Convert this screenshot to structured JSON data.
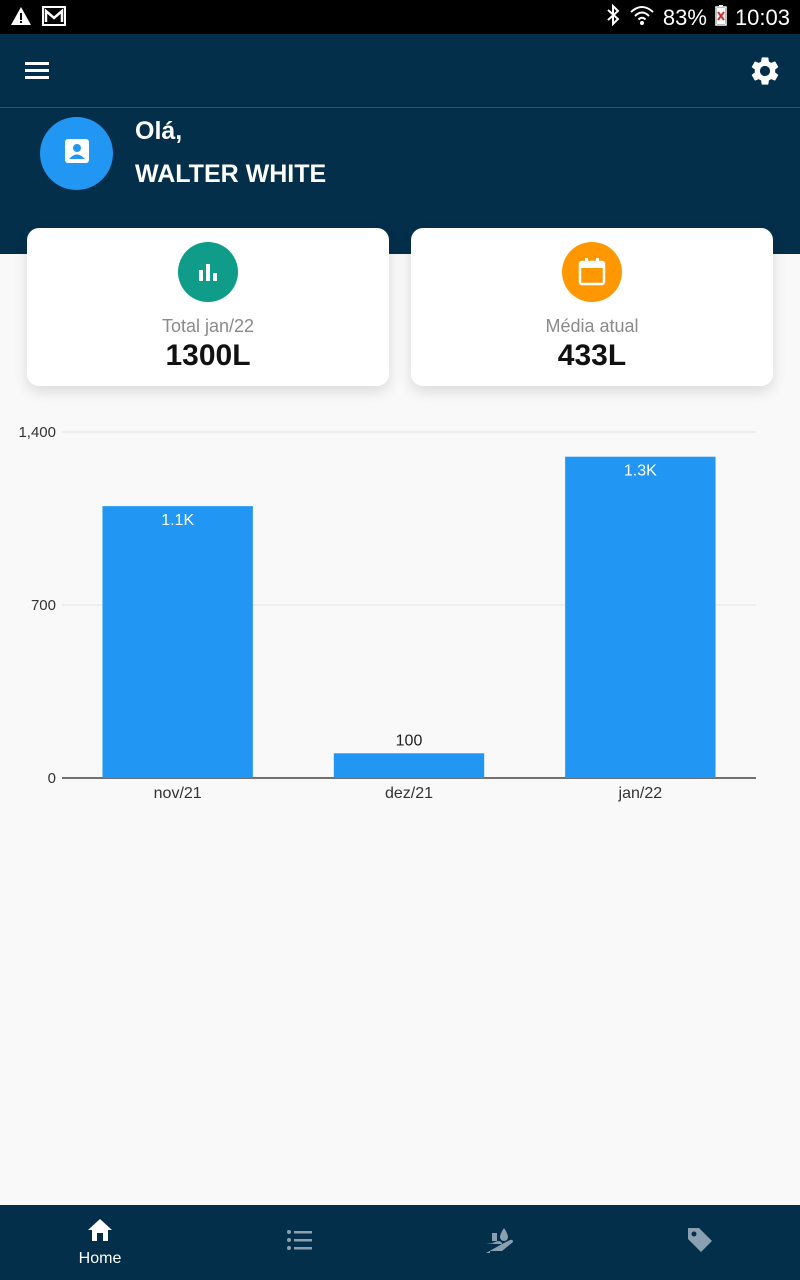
{
  "status_bar": {
    "battery": "83%",
    "time": "10:03",
    "icons": [
      "warning-icon",
      "gmail-icon",
      "bluetooth-icon",
      "wifi-icon",
      "battery-icon"
    ]
  },
  "header": {
    "greeting": "Olá,",
    "user_name": "WALTER WHITE",
    "icons": [
      "menu-icon",
      "gear-icon",
      "contact-icon"
    ]
  },
  "cards": [
    {
      "label": "Total jan/22",
      "value": "1300L",
      "icon": "bar-chart-icon",
      "color": "#0f9d8a"
    },
    {
      "label": "Média atual",
      "value": "433L",
      "icon": "calendar-icon",
      "color": "#ff9800"
    }
  ],
  "chart_data": {
    "type": "bar",
    "categories": [
      "nov/21",
      "dez/21",
      "jan/22"
    ],
    "values": [
      1100,
      100,
      1300
    ],
    "data_labels": [
      "1.1K",
      "100",
      "1.3K"
    ],
    "y_ticks": [
      "0",
      "700",
      "1,400"
    ],
    "ylim": [
      0,
      1400
    ],
    "grid": true,
    "bar_color": "#2196f3"
  },
  "bottom_nav": {
    "items": [
      {
        "label": "Home",
        "icon": "home-icon",
        "active": true
      },
      {
        "label": "",
        "icon": "list-icon",
        "active": false
      },
      {
        "label": "",
        "icon": "water-hand-icon",
        "active": false
      },
      {
        "label": "",
        "icon": "tag-icon",
        "active": false
      }
    ]
  },
  "colors": {
    "primary_dark": "#042f4b",
    "accent_blue": "#2196f3",
    "teal": "#0f9d8a",
    "orange": "#ff9800",
    "inactive_icon": "#8aa0b0"
  }
}
